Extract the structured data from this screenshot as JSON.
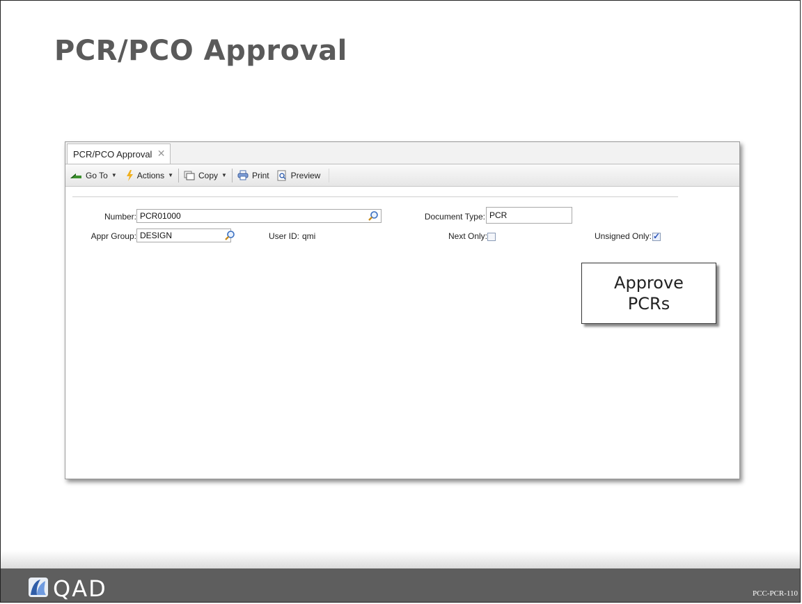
{
  "slide": {
    "title": "PCR/PCO Approval",
    "code": "PCC-PCR-110",
    "logo_text": "QAD"
  },
  "window": {
    "tab_label": "PCR/PCO Approval",
    "tab_close": "✕",
    "toolbar": {
      "goto_label": "Go To",
      "actions_label": "Actions",
      "copy_label": "Copy",
      "print_label": "Print",
      "preview_label": "Preview"
    },
    "form": {
      "number_label": "Number:",
      "number_value": "PCR01000",
      "document_type_label": "Document Type:",
      "document_type_value": "PCR",
      "appr_group_label": "Appr Group:",
      "appr_group_value": "DESIGN",
      "user_id_label": "User ID:",
      "user_id_value": "qmi",
      "next_only_label": "Next Only:",
      "next_only_checked": false,
      "unsigned_only_label": "Unsigned Only:",
      "unsigned_only_checked": true
    }
  },
  "callout": {
    "line1": "Approve",
    "line2": "PCRs"
  },
  "colors": {
    "title": "#5a5a5a",
    "footer": "#5e5e5e",
    "checkbox_tick": "#2a52b8"
  },
  "icons": [
    "goto-arrow-icon",
    "actions-lightning-icon",
    "copy-icon",
    "print-icon",
    "preview-icon",
    "search-icon",
    "close-icon",
    "qad-logo-icon"
  ]
}
